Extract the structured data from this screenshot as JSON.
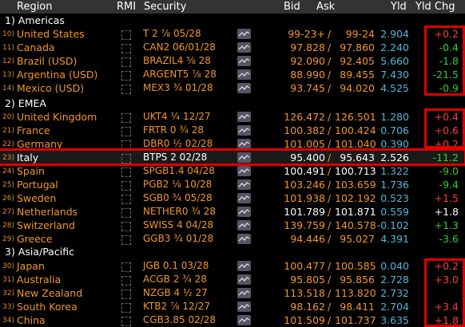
{
  "header": {
    "region": "Region",
    "rmi": "RMI",
    "security": "Security",
    "bid": "Bid",
    "ask": "Ask",
    "yld": "Yld",
    "yld_chg": "Yld Chg"
  },
  "groups": [
    {
      "label": "1) Americas"
    },
    {
      "label": "2) EMEA"
    },
    {
      "label": "3) Asia/Pacific"
    }
  ],
  "rows": [
    {
      "idx": "10)",
      "name": "United States",
      "security": "T 2 ⅞ 05/28",
      "bid": "99-23+",
      "ask": "99-24",
      "yld": "2.904",
      "chg": "+0.2",
      "dir": "pos"
    },
    {
      "idx": "11)",
      "name": "Canada",
      "security": "CAN2 06/01/28",
      "bid": "97.828",
      "ask": "97.860",
      "yld": "2.240",
      "chg": "-0.4",
      "dir": "neg"
    },
    {
      "idx": "12)",
      "name": "Brazil (USD)",
      "security": "BRAZIL4 ⅝ 28",
      "bid": "92.090",
      "ask": "92.405",
      "yld": "5.660",
      "chg": "-1.8",
      "dir": "neg"
    },
    {
      "idx": "13)",
      "name": "Argentina (USD)",
      "security": "ARGENT5 ⅞ 28",
      "bid": "88.990",
      "ask": "89.455",
      "yld": "7.430",
      "chg": "-21.5",
      "dir": "neg"
    },
    {
      "idx": "14)",
      "name": "Mexico (USD)",
      "security": "MEX3 ¾ 01/28",
      "bid": "93.745",
      "ask": "94.020",
      "yld": "4.525",
      "chg": "-0.9",
      "dir": "neg"
    },
    {
      "idx": "20)",
      "name": "United Kingdom",
      "security": "UKT4 ¼ 12/27",
      "bid": "126.472",
      "ask": "126.501",
      "yld": "1.280",
      "chg": "+0.4",
      "dir": "pos"
    },
    {
      "idx": "21)",
      "name": "France",
      "security": "FRTR 0 ¾ 28",
      "bid": "100.382",
      "ask": "100.424",
      "yld": "0.706",
      "chg": "+0.6",
      "dir": "pos"
    },
    {
      "idx": "22)",
      "name": "Germany",
      "security": "DBR0 ½ 02/28",
      "bid": "101.005",
      "ask": "101.040",
      "yld": "0.390",
      "chg": "+0.2",
      "dir": "pos"
    },
    {
      "idx": "23)",
      "name": "Italy",
      "security": "BTPS 2 02/28",
      "bid": "95.400",
      "ask": "95.643",
      "yld": "2.526",
      "chg": "-11.2",
      "dir": "neg"
    },
    {
      "idx": "24)",
      "name": "Spain",
      "security": "SPGB1.4 04/28",
      "bid": "100.491",
      "ask": "100.713",
      "yld": "1.322",
      "chg": "-9.0",
      "dir": "neg"
    },
    {
      "idx": "25)",
      "name": "Portugal",
      "security": "PGB2 ⅛ 10/28",
      "bid": "103.246",
      "ask": "103.659",
      "yld": "1.736",
      "chg": "-9.4",
      "dir": "neg"
    },
    {
      "idx": "26)",
      "name": "Sweden",
      "security": "SGB0 ¾ 05/28",
      "bid": "101.938",
      "ask": "102.192",
      "yld": "0.523",
      "chg": "+1.5",
      "dir": "pos"
    },
    {
      "idx": "27)",
      "name": "Netherlands",
      "security": "NETHER0 ¾ 28",
      "bid": "101.789",
      "ask": "101.871",
      "yld": "0.559",
      "chg": "+1.8",
      "dir": "wht"
    },
    {
      "idx": "28)",
      "name": "Switzerland",
      "security": "SWISS 4 04/28",
      "bid": "139.759",
      "ask": "140.578",
      "yld": "-0.102",
      "chg": "+1.3",
      "dir": "neg"
    },
    {
      "idx": "29)",
      "name": "Greece",
      "security": "GGB3 ¾ 01/28",
      "bid": "94.446",
      "ask": "95.027",
      "yld": "4.391",
      "chg": "-3.6",
      "dir": "neg"
    },
    {
      "idx": "30)",
      "name": "Japan",
      "security": "JGB 0.1 03/28",
      "bid": "100.477",
      "ask": "100.585",
      "yld": "0.040",
      "chg": "+0.2",
      "dir": "pos"
    },
    {
      "idx": "31)",
      "name": "Australia",
      "security": "ACGB 2 ¾ 28",
      "bid": "95.805",
      "ask": "95.856",
      "yld": "2.728",
      "chg": "+3.0",
      "dir": "pos"
    },
    {
      "idx": "32)",
      "name": "New Zealand",
      "security": "NZGB 4 ½ 27",
      "bid": "113.518",
      "ask": "113.820",
      "yld": "2.732",
      "chg": "",
      "dir": "pos"
    },
    {
      "idx": "33)",
      "name": "South Korea",
      "security": "KTB2 ⅞ 12/27",
      "bid": "98.162",
      "ask": "98.411",
      "yld": "2.704",
      "chg": "+3.4",
      "dir": "pos"
    },
    {
      "idx": "34)",
      "name": "China",
      "security": "CGB3.85 02/28",
      "bid": "101.509",
      "ask": "101.737",
      "yld": "3.635",
      "chg": "+1.8",
      "dir": "pos"
    }
  ],
  "icons": {
    "rmi": "dashed-checkbox-icon",
    "chart": "mini-chart-icon"
  },
  "colors": {
    "accent": "#f0962c",
    "yield": "#4fb7d8",
    "up": "#ff3b3b",
    "down": "#33cc33",
    "highlight": "#e00000"
  }
}
